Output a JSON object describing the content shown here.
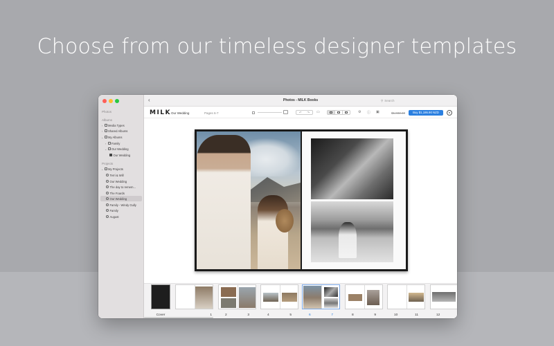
{
  "headline": "Choose from our timeless designer templates",
  "window": {
    "title": "Photos - MILK Books",
    "search_placeholder": "Search"
  },
  "sidebar": {
    "photos_label": "Photos",
    "albums_label": "Albums",
    "albums": [
      {
        "label": "Media Types"
      },
      {
        "label": "Shared Albums"
      },
      {
        "label": "My Albums"
      },
      {
        "label": "Family"
      },
      {
        "label": "Our Wedding"
      },
      {
        "label": "Our Wedding"
      }
    ],
    "projects_label": "Projects",
    "projects": [
      {
        "label": "My Projects"
      },
      {
        "label": "Terri & Will"
      },
      {
        "label": "Our Wedding"
      },
      {
        "label": "The day to remem..."
      },
      {
        "label": "The Foards"
      },
      {
        "label": "Our Wedding"
      },
      {
        "label": "Family - Windy Gully"
      },
      {
        "label": "Family"
      },
      {
        "label": "August"
      }
    ]
  },
  "toolbar": {
    "logo": "MILK",
    "project_name": "Our Wedding",
    "pages_label": "Pages 6-7",
    "old_price": "$1,682.40",
    "buy_label": "Buy $1,186.90 NZD"
  },
  "filmstrip": {
    "thumbs": [
      {
        "labels": [
          "Cover"
        ]
      },
      {
        "labels": [
          "",
          "1"
        ]
      },
      {
        "labels": [
          "2",
          "3"
        ]
      },
      {
        "labels": [
          "4",
          "5"
        ]
      },
      {
        "labels": [
          "6",
          "7"
        ],
        "selected": true
      },
      {
        "labels": [
          "8",
          "9"
        ]
      },
      {
        "labels": [
          "10",
          "11"
        ]
      },
      {
        "labels": [
          "12"
        ]
      }
    ]
  },
  "colors": {
    "accent": "#2a7fe0",
    "background": "#a8a9ad"
  }
}
